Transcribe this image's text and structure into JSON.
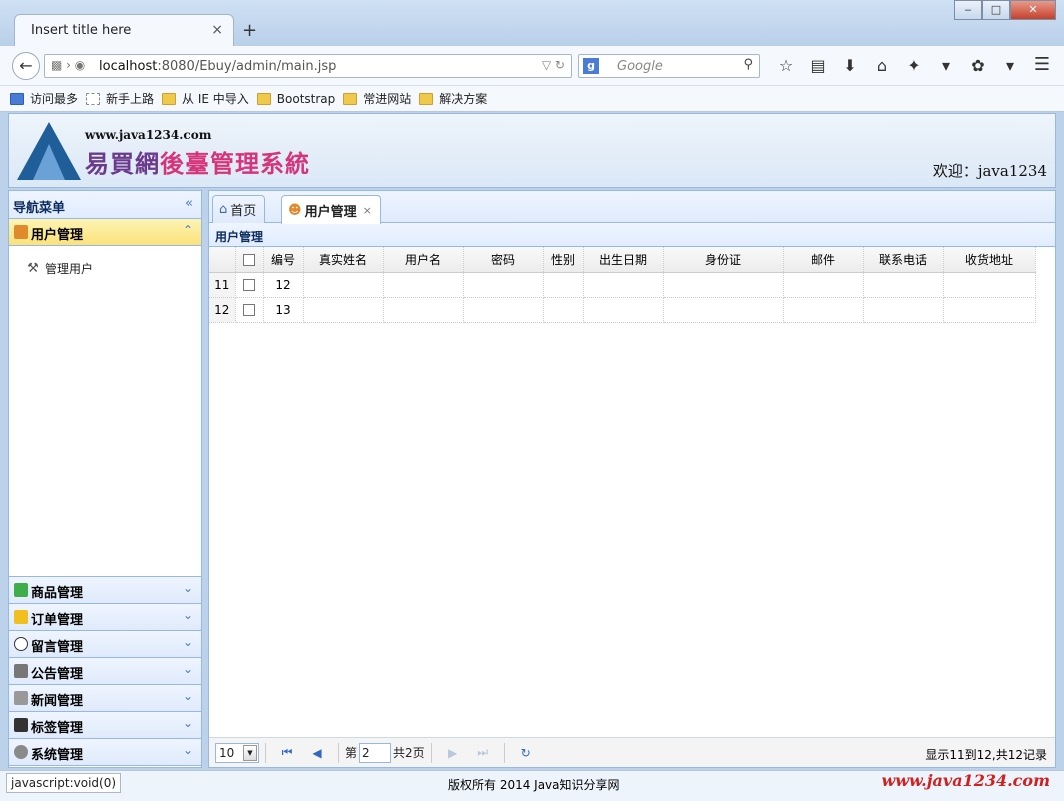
{
  "browser": {
    "tab_title": "Insert title here",
    "tab_close": "×",
    "new_tab": "+",
    "url_host": "localhost",
    "url_rest": ":8080/Ebuy/admin/main.jsp",
    "search_engine_letter": "g",
    "search_placeholder": "Google",
    "window_buttons": {
      "minimize": "‒",
      "maximize": "□",
      "close": "✕"
    }
  },
  "bookmarks": [
    {
      "label": "访问最多",
      "icon": "blue"
    },
    {
      "label": "新手上路",
      "icon": "blank"
    },
    {
      "label": "从 IE 中导入",
      "icon": "folder"
    },
    {
      "label": "Bootstrap",
      "icon": "folder"
    },
    {
      "label": "常进网站",
      "icon": "folder"
    },
    {
      "label": "解决方案",
      "icon": "folder"
    }
  ],
  "header": {
    "site_url": "www.java1234.com",
    "site_name_a": "易買網",
    "site_name_b": "後臺管理系統",
    "welcome": "欢迎：java1234"
  },
  "sidebar": {
    "title": "导航菜单",
    "active_section": {
      "label": "用户管理",
      "icon_color": "#e08a2e"
    },
    "sub_items": [
      {
        "label": "管理用户",
        "icon": "tools-icon"
      }
    ],
    "sections": [
      {
        "label": "商品管理",
        "icon_color": "#3fae4a"
      },
      {
        "label": "订单管理",
        "icon_color": "#f0c020"
      },
      {
        "label": "留言管理",
        "icon_color": "#ffffff"
      },
      {
        "label": "公告管理",
        "icon_color": "#777777"
      },
      {
        "label": "新闻管理",
        "icon_color": "#999999"
      },
      {
        "label": "标签管理",
        "icon_color": "#333333"
      },
      {
        "label": "系统管理",
        "icon_color": "#8a8a8a"
      }
    ]
  },
  "main": {
    "tabs": [
      {
        "label": "首页",
        "icon": "home-icon"
      },
      {
        "label": "用户管理",
        "icon": "users-icon",
        "close": "×"
      }
    ],
    "grid_title": "用户管理",
    "columns": [
      "编号",
      "真实姓名",
      "用户名",
      "密码",
      "性别",
      "出生日期",
      "身份证",
      "邮件",
      "联系电话",
      "收货地址"
    ],
    "rows": [
      {
        "rownum": "11",
        "id": "12",
        "cells": [
          "",
          "",
          "",
          "",
          "",
          "",
          "",
          "",
          ""
        ]
      },
      {
        "rownum": "12",
        "id": "13",
        "cells": [
          "",
          "",
          "",
          "",
          "",
          "",
          "",
          "",
          ""
        ]
      }
    ],
    "pager": {
      "page_size": "10",
      "page_label": "第",
      "page_value": "2",
      "total_pages": "共2页",
      "info": "显示11到12,共12记录"
    }
  },
  "footer": {
    "status": "javascript:void(0)",
    "copyright": "版权所有  2014  Java知识分享网",
    "watermark": "www.java1234.com"
  }
}
